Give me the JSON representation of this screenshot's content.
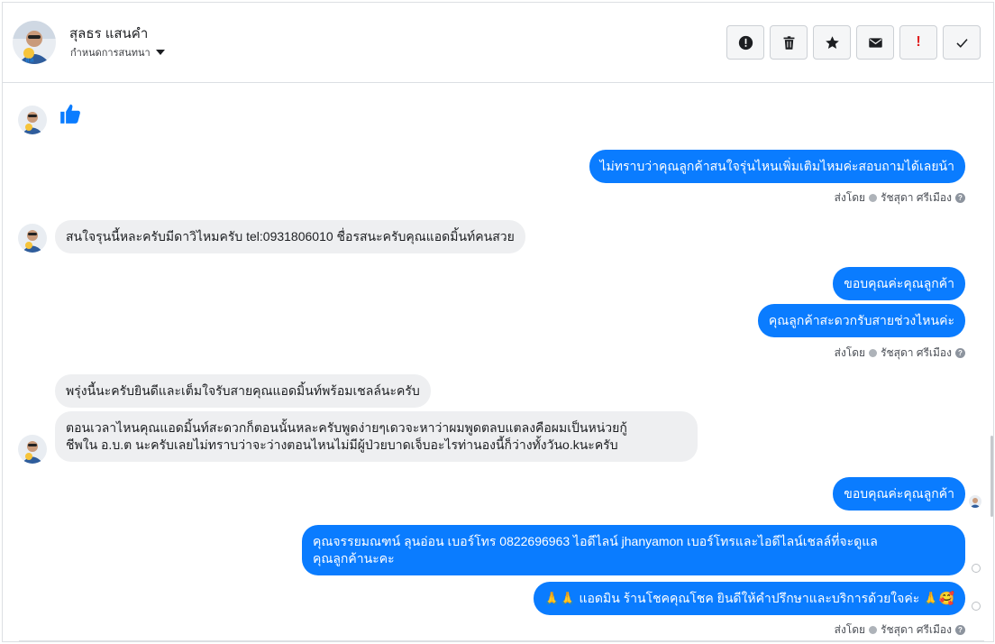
{
  "header": {
    "contact_name": "สุลธร แสนคำ",
    "assign_label": "กำหนดการสนทนา",
    "actions": [
      {
        "icon": "alert-circle-icon",
        "name": "mark-spam-button"
      },
      {
        "icon": "trash-icon",
        "name": "delete-button"
      },
      {
        "icon": "star-icon",
        "name": "star-button"
      },
      {
        "icon": "envelope-icon",
        "name": "mark-unread-button"
      },
      {
        "icon": "exclamation-icon",
        "name": "follow-up-button"
      },
      {
        "icon": "check-icon",
        "name": "mark-done-button"
      }
    ]
  },
  "messages": {
    "m1_text": "ไม่ทราบว่าคุณลูกค้าสนใจรุ่นไหนเพิ่มเติมไหมค่ะสอบถามได้เลยน้า",
    "m2_text": "สนใจรุนนี้หละครับมีดาวิไหมครับ  tel:0931806010  ชื่อรสนะครับคุณแอดมิ้นท์คนสวย",
    "m3_text": "ขอบคุณค่ะคุณลูกค้า",
    "m4_text": "คุณลูกค้าสะดวกรับสายช่วงไหนค่ะ",
    "m5_text": "พรุ่งนี้นะครับยินดีและเต็มใจรับสายคุณแอดมิ้นท์พร้อมเชลล์นะครับ",
    "m6_line1": "ตอนเวลาไหนคุณแอดมิ้นท์สะดวกก็ตอนนั้นหละครับพูดง่ายๆเดวจะหาว่าผมพูดตลบแตลงคือผมเป็นหน่วยกู้",
    "m6_line2": "ชีพใน อ.บ.ต นะครับเลยไม่ทราบว่าจะว่างตอนไหนไม่มีผู้ป่วยบาดเจ็บอะไรท่านองนี้ก็ว่างทั้งวันo.kนะครับ",
    "m7_text": "ขอบคุณค่ะคุณลูกค้า",
    "m8_line1": "คุณจรรยมณฑน์ ลุนอ่อน เบอร์โทร 0822696963  ไอดีไลน์  jhanyamon  เบอร์โทรและไอดีไลน์เชลล์ที่จะดูแล",
    "m8_line2": "คุณลูกค้านะคะ",
    "m9_prefix": "🙏🙏",
    "m9_text": "แอดมิน ร้านโชคคุณโชค ยินดีให้คำปรึกษาและบริการด้วยใจค่ะ",
    "m9_suffix": "🙏🥰"
  },
  "meta": {
    "sent_by_label": "ส่งโดย",
    "agent_name": "รัชสุดา ศรีเมือง",
    "help_glyph": "?"
  },
  "colors": {
    "outgoing": "#0a7cff",
    "incoming": "#eeeff1",
    "like": "#0a7cff"
  }
}
